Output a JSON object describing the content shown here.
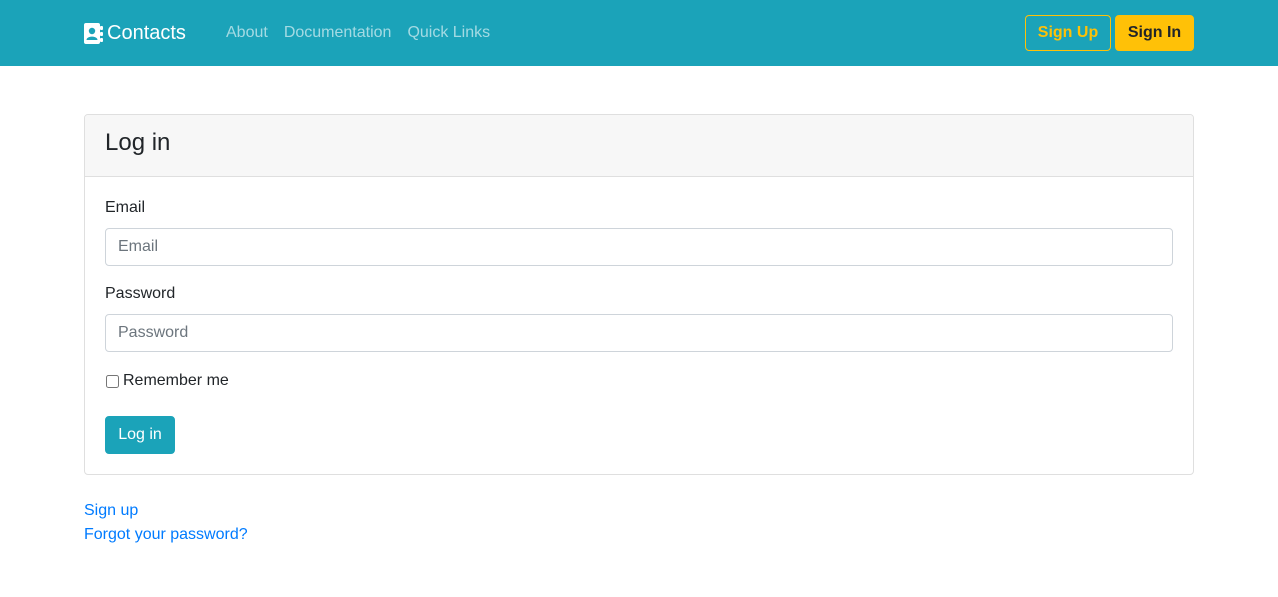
{
  "navbar": {
    "brand": "Contacts",
    "brand_icon": "address-book-icon",
    "links": [
      "About",
      "Documentation",
      "Quick Links"
    ],
    "signup_label": "Sign Up",
    "signin_label": "Sign In",
    "colors": {
      "background": "#1ba3b9",
      "accent": "#ffc107"
    }
  },
  "login_card": {
    "title": "Log in",
    "email_label": "Email",
    "email_placeholder": "Email",
    "email_value": "",
    "password_label": "Password",
    "password_placeholder": "Password",
    "password_value": "",
    "remember_label": "Remember me",
    "remember_checked": false,
    "submit_label": "Log in"
  },
  "footer_links": {
    "signup": "Sign up",
    "forgot": "Forgot your password?",
    "link_color": "#007bff"
  }
}
